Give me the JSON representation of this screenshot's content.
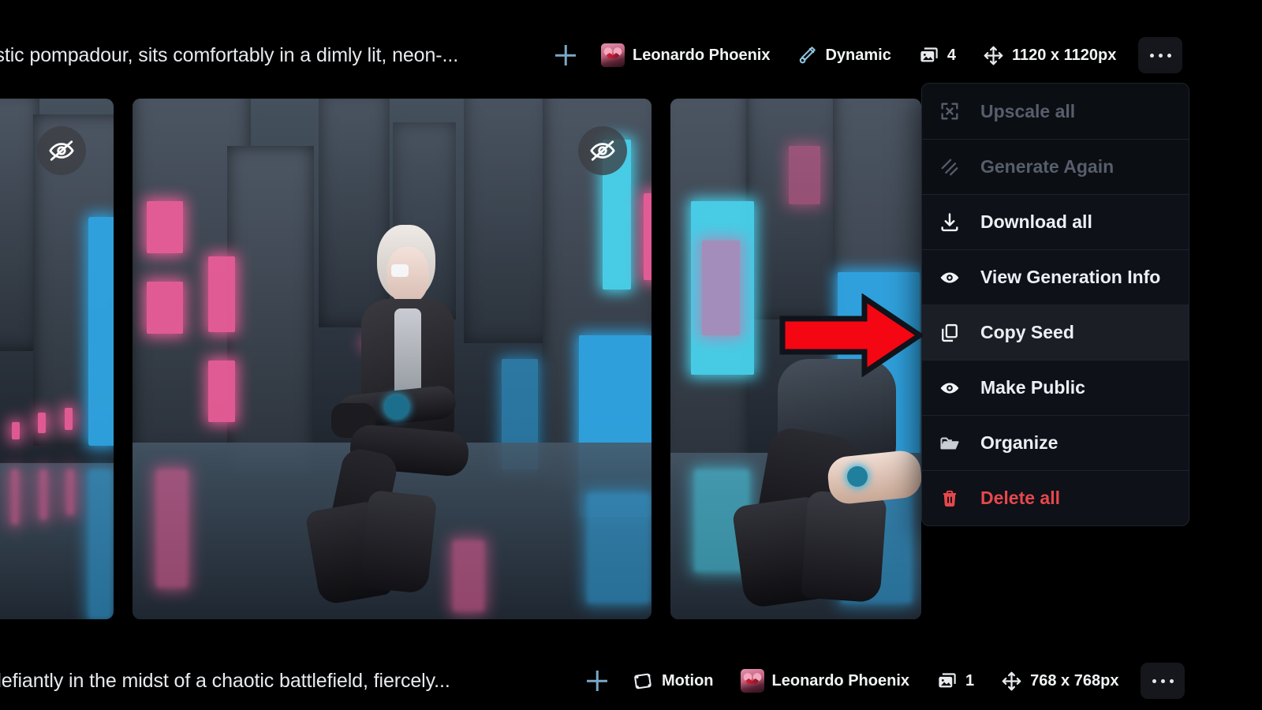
{
  "top_toolbar": {
    "prompt": "istic pompadour, sits comfortably in a dimly lit, neon-...",
    "add_label": "+",
    "model": "Leonardo Phoenix",
    "preset": "Dynamic",
    "image_count": "4",
    "dimensions": "1120 x 1120px",
    "more_label": "•••",
    "icons": {
      "add": "plus-icon",
      "avatar": "model-avatar-icon",
      "preset": "magic-wand-icon",
      "count": "images-stack-icon",
      "dimensions": "resize-move-icon",
      "more": "more-options-icon"
    }
  },
  "bottom_toolbar": {
    "prompt": "defiantly in the midst of a chaotic battlefield, fiercely...",
    "add_label": "+",
    "motion": "Motion",
    "model": "Leonardo Phoenix",
    "image_count": "1",
    "dimensions": "768 x 768px",
    "more_label": "•••",
    "icons": {
      "add": "plus-icon",
      "motion": "motion-film-icon",
      "avatar": "model-avatar-icon",
      "count": "images-stack-icon",
      "dimensions": "resize-move-icon",
      "more": "more-options-icon"
    }
  },
  "gallery": {
    "items": [
      {
        "name": "generation-thumb-left",
        "badge_icon": "eye-off-icon",
        "badge_title": "Private"
      },
      {
        "name": "generation-thumb-center",
        "badge_icon": "eye-off-icon",
        "badge_title": "Private"
      },
      {
        "name": "generation-thumb-right",
        "badge_icon": "eye-off-icon",
        "badge_title": "Private"
      }
    ]
  },
  "context_menu": {
    "items": [
      {
        "label": "Upscale all",
        "icon": "upscale-icon",
        "state": "disabled"
      },
      {
        "label": "Generate Again",
        "icon": "generate-again-icon",
        "state": "disabled"
      },
      {
        "label": "Download all",
        "icon": "download-icon",
        "state": "enabled"
      },
      {
        "label": "View Generation Info",
        "icon": "eye-icon",
        "state": "enabled"
      },
      {
        "label": "Copy Seed",
        "icon": "copy-icon",
        "state": "hovered"
      },
      {
        "label": "Make Public",
        "icon": "eye-icon",
        "state": "enabled"
      },
      {
        "label": "Organize",
        "icon": "folder-icon",
        "state": "enabled"
      },
      {
        "label": "Delete all",
        "icon": "trash-icon",
        "state": "danger"
      }
    ]
  },
  "annotation": {
    "type": "arrow",
    "points_to": "Copy Seed",
    "fill_color": "#f40613",
    "stroke_color": "#10131a"
  },
  "colors": {
    "background": "#000000",
    "menu_background": "#0e1117",
    "menu_hover": "#1b1e24",
    "menu_disabled_text": "#575e6b",
    "text_primary": "#eceff3",
    "danger": "#e5484d",
    "accent_plus": "#7aa7c7"
  }
}
